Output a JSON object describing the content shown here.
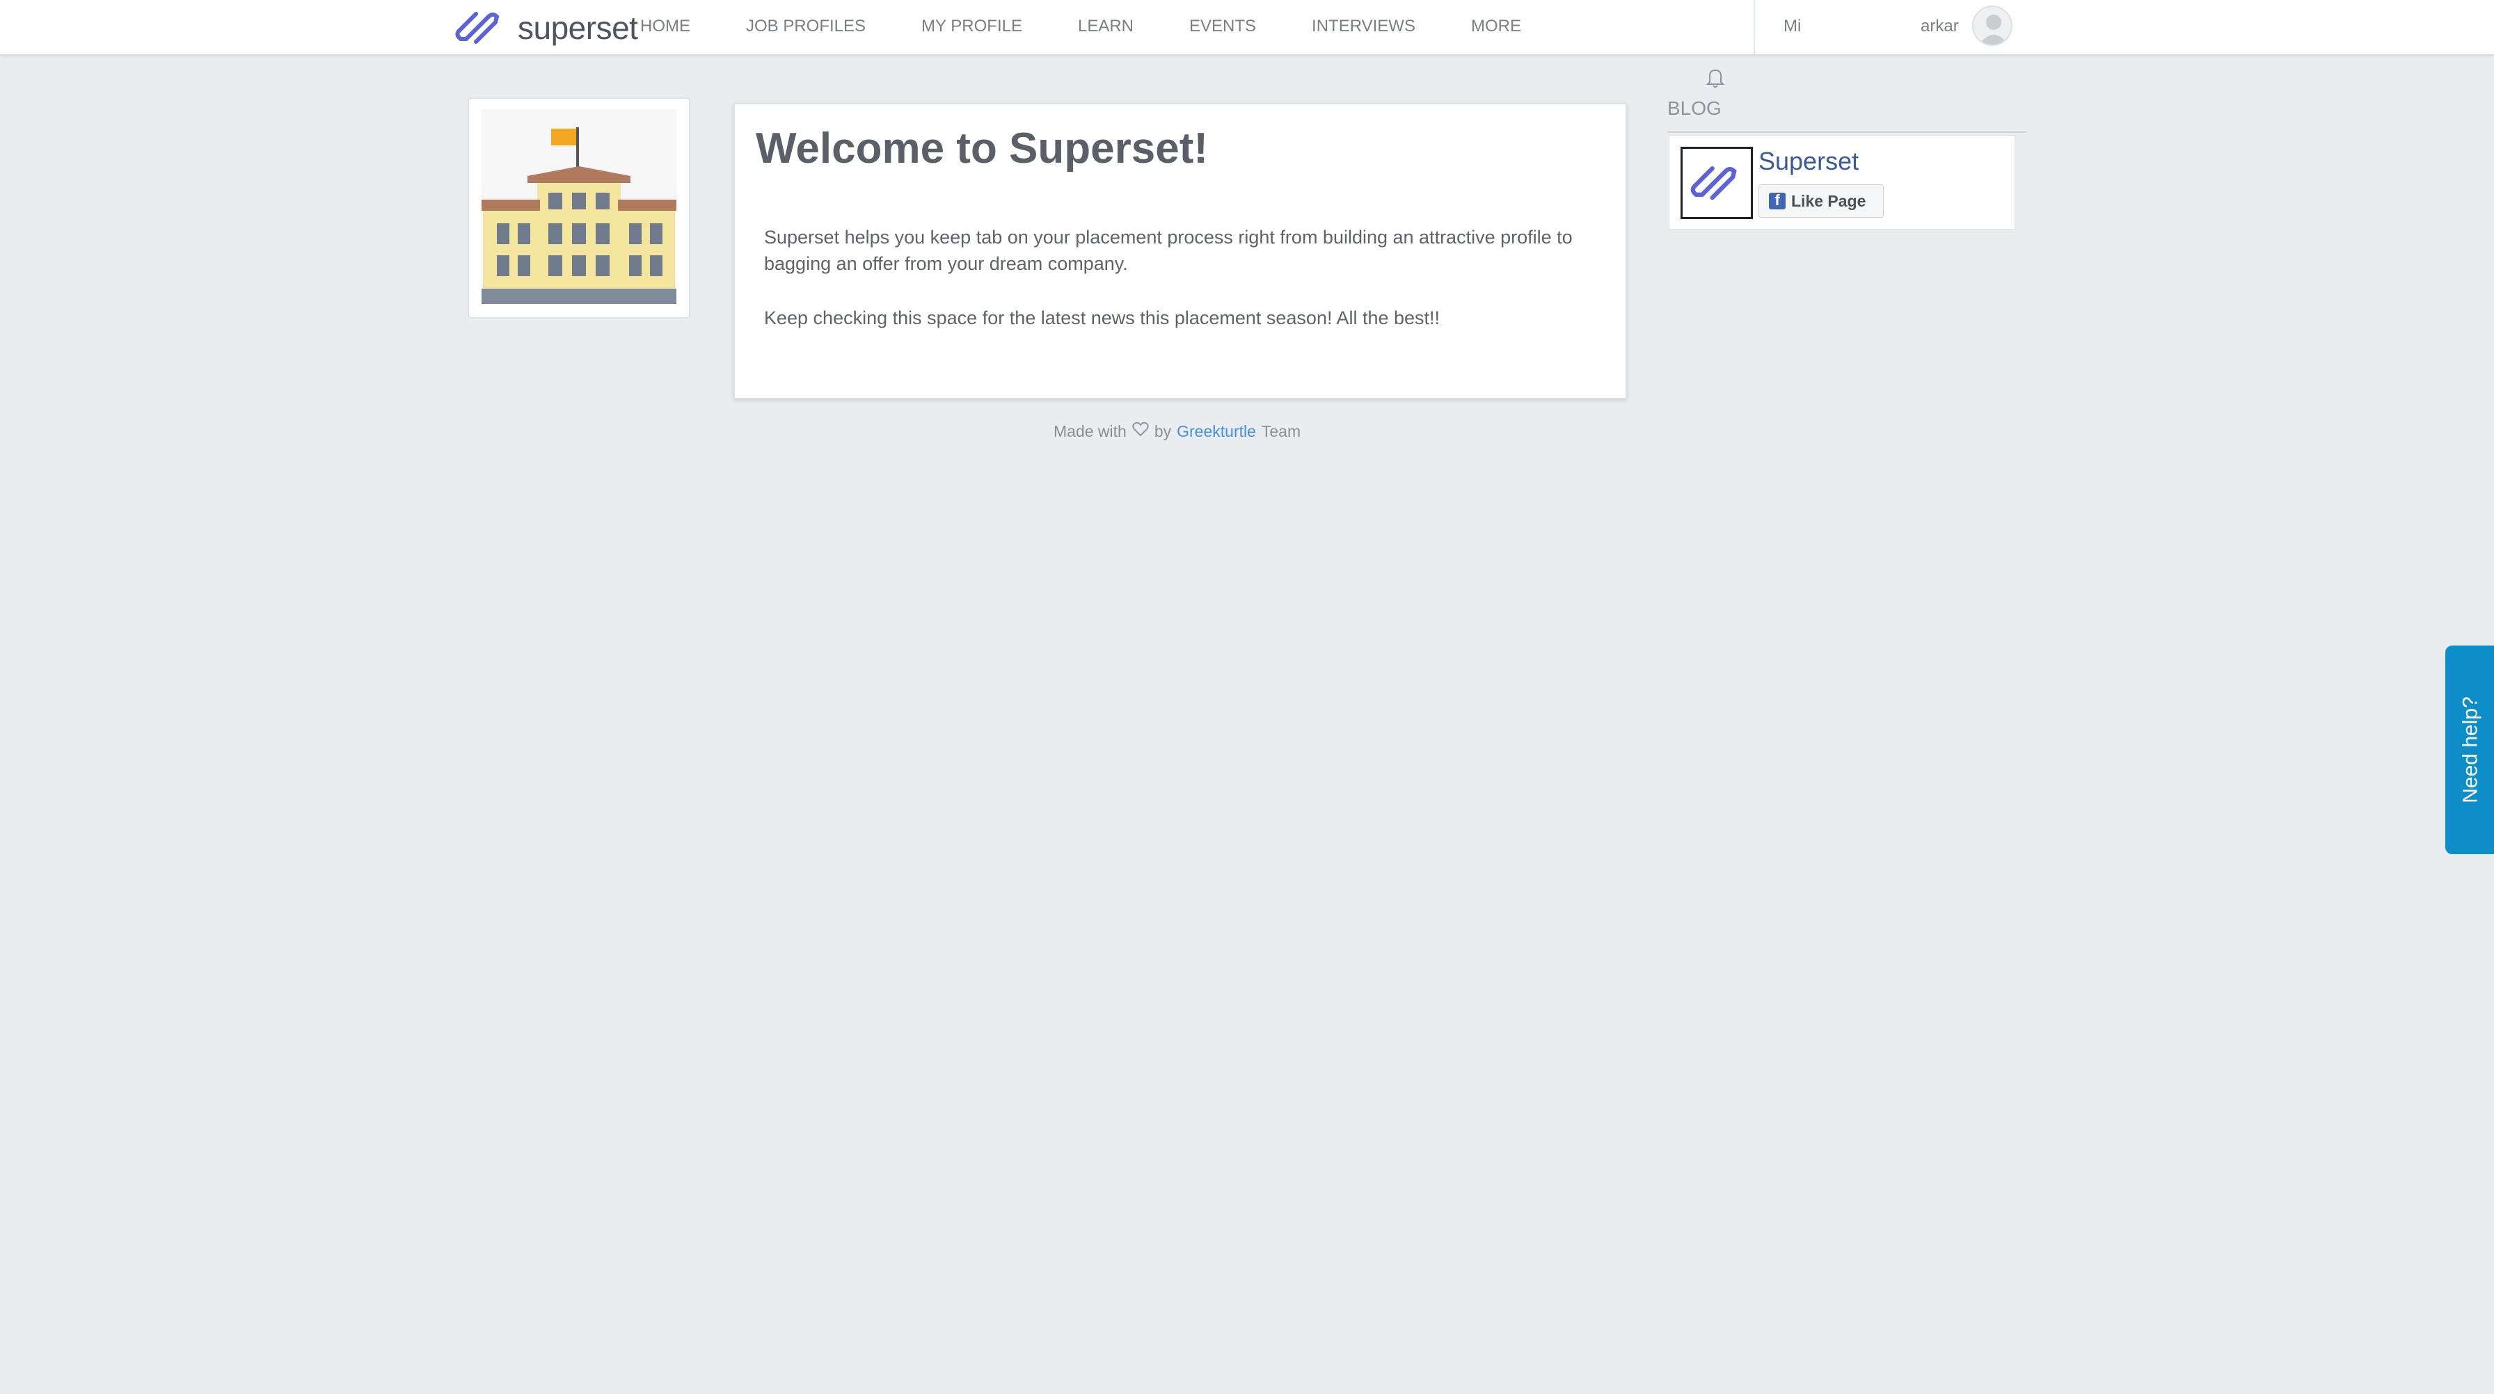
{
  "brand": {
    "name": "superset"
  },
  "nav": {
    "items": [
      {
        "label": "HOME"
      },
      {
        "label": "JOB PROFILES"
      },
      {
        "label": "MY PROFILE"
      },
      {
        "label": "LEARN"
      },
      {
        "label": "EVENTS"
      },
      {
        "label": "INTERVIEWS"
      },
      {
        "label": "MORE"
      }
    ],
    "mi": "Mi",
    "user": "arkar"
  },
  "welcome": {
    "title": "Welcome to Superset!",
    "p1": "Superset helps you keep tab on your placement process right from building an attractive profile to bagging an offer from your dream company.",
    "p2": "Keep checking this space for the latest news this placement season! All the best!!"
  },
  "footer": {
    "made_with": "Made with",
    "by": "by",
    "link": "Greekturtle",
    "team": "Team"
  },
  "blog": {
    "title": "BLOG",
    "page_name": "Superset",
    "like_label": "Like Page"
  },
  "help": {
    "label": "Need help?"
  },
  "colors": {
    "background": "#eaedf0",
    "brand_blue": "#5b63d6",
    "link": "#4a8fd9",
    "help_tab": "#0d8ec9",
    "facebook": "#3b5998"
  },
  "icons": {
    "logo": "superset-logo-icon",
    "avatar": "user-avatar-icon",
    "bell": "bell-icon",
    "heart": "heart-icon",
    "facebook": "facebook-icon",
    "college": "college-building-icon"
  }
}
